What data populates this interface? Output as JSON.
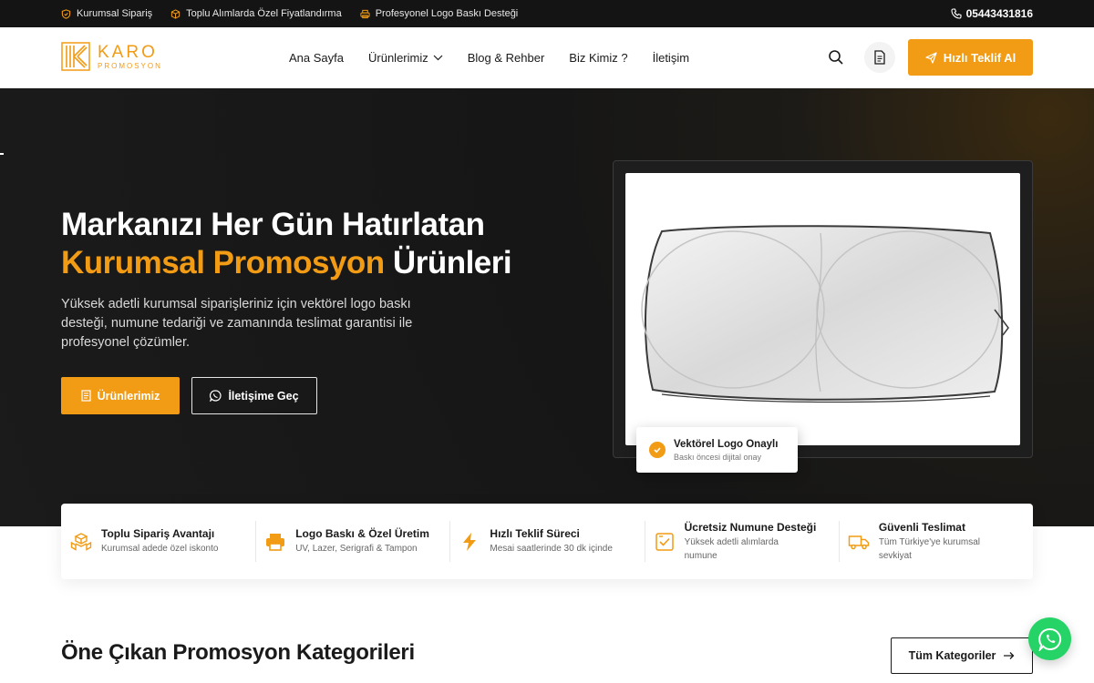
{
  "topbar": {
    "items": [
      {
        "label": "Kurumsal Sipariş",
        "icon": "shield-icon"
      },
      {
        "label": "Toplu Alımlarda Özel Fiyatlandırma",
        "icon": "box-icon"
      },
      {
        "label": "Profesyonel Logo Baskı Desteği",
        "icon": "printer-icon"
      }
    ],
    "phone": "05443431816"
  },
  "header": {
    "logo_main": "KARO",
    "logo_sub": "PROMOSYON",
    "nav": [
      "Ana Sayfa",
      "Ürünlerimiz",
      "Blog & Rehber",
      "Biz Kimiz ?",
      "İletişim"
    ],
    "quote_label": "Hızlı Teklif Al",
    "accent": "#f29b14"
  },
  "hero": {
    "title_line1": "Markanızı Her Gün Hatırlatan",
    "title_accent": "Kurumsal Promosyon",
    "title_rest": " Ürünleri",
    "lead": "Yüksek adetli kurumsal siparişleriniz için vektörel logo baskı desteği, numune tedariği ve zamanında teslimat garantisi ile profesyonel çözümler.",
    "primary_label": "Ürünlerimiz",
    "secondary_label": "İletişime Geç",
    "badge_title": "Vektörel Logo Onaylı",
    "badge_sub": "Baskı öncesi dijital onay"
  },
  "features": [
    {
      "title": "Toplu Sipariş Avantajı",
      "desc": "Kurumsal adede özel iskonto",
      "icon": "boxes-icon"
    },
    {
      "title": "Logo Baskı & Özel Üretim",
      "desc": "UV, Lazer, Serigrafi & Tampon",
      "icon": "printer-icon"
    },
    {
      "title": "Hızlı Teklif Süreci",
      "desc": "Mesai saatlerinde 30 dk içinde",
      "icon": "bolt-icon"
    },
    {
      "title": "Ücretsiz Numune Desteği",
      "desc": "Yüksek adetli alımlarda numune",
      "icon": "checklist-icon"
    },
    {
      "title": "Güvenli Teslimat",
      "desc": "Tüm Türkiye'ye kurumsal sevkiyat",
      "icon": "truck-icon"
    }
  ],
  "section": {
    "title": "Öne Çıkan Promosyon Kategorileri",
    "all_label": "Tüm Kategoriler"
  }
}
